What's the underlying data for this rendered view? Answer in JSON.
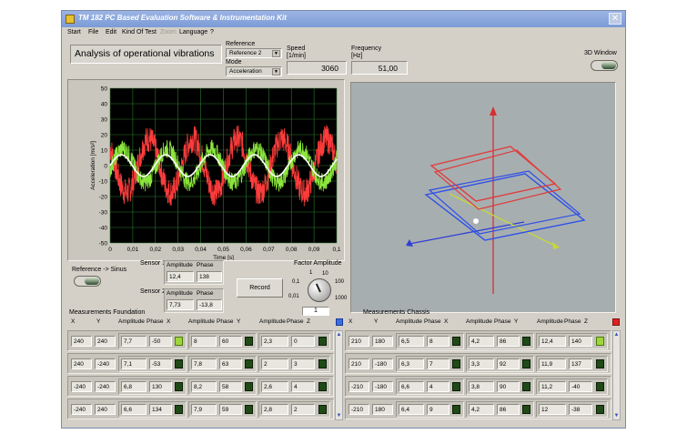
{
  "window": {
    "title": "TM 182 PC Based Evaluation Software & Instrumentation Kit",
    "close_label": "✕"
  },
  "menu": [
    "Start",
    "File",
    "Edit",
    "Kind Of Test",
    "Zoom",
    "Language",
    "?"
  ],
  "header": {
    "analysis_title": "Analysis of operational vibrations",
    "reference_label": "Reference",
    "reference_value": "Reference 2",
    "mode_label": "Mode",
    "mode_value": "Acceleration",
    "speed_label": "Speed",
    "speed_unit": "[1/min]",
    "speed_value": "3060",
    "frequency_label": "Frequency",
    "frequency_unit": "[Hz]",
    "frequency_value": "51,00",
    "window3d_label": "3D Window"
  },
  "chart_data": {
    "type": "line",
    "xlabel": "Time [s]",
    "ylabel": "Acceleration [m/s²]",
    "xlim": [
      0,
      0.1
    ],
    "ylim": [
      -50,
      50
    ],
    "xticks": [
      "0",
      "0,01",
      "0,02",
      "0,03",
      "0,04",
      "0,05",
      "0,06",
      "0,07",
      "0,08",
      "0,09",
      "0,1"
    ],
    "yticks": [
      "50",
      "40",
      "30",
      "20",
      "10",
      "0",
      "-10",
      "-20",
      "-30",
      "-40",
      "-50"
    ],
    "grid": true,
    "background": "#000000",
    "series": [
      {
        "color": "#ff3c3c",
        "amplitude": 12.4,
        "phase_deg": 138,
        "frequency_hz": 51,
        "noise": 9
      },
      {
        "color": "#8ce63c",
        "amplitude": 7.73,
        "phase_deg": -13.8,
        "frequency_hz": 51,
        "noise": 6
      },
      {
        "color": "#ffffff",
        "amplitude": 5,
        "phase_deg": 0,
        "frequency_hz": 51,
        "noise": 0
      }
    ]
  },
  "controls": {
    "reference_sinus_label": "Reference -> Sinus",
    "sensor1_label": "Sensor 1",
    "sensor2_label": "Sensor 2",
    "amplitude_label": "Amplitude",
    "phase_label": "Phase",
    "sensor1_amplitude": "12,4",
    "sensor1_phase": "138",
    "sensor2_amplitude": "7,73",
    "sensor2_phase": "-13,8",
    "record_label": "Record",
    "factor_label": "Factor Amplitude",
    "knob_ticks": [
      "0,01",
      "0,1",
      "1",
      "10",
      "100",
      "1000"
    ],
    "factor_value": "1"
  },
  "foundation": {
    "title": "Measurements Foundation",
    "headers": [
      "X",
      "Y",
      "Amplitude",
      "Phase",
      "X",
      "Amplitude",
      "Phase",
      "Y",
      "Amplitude",
      "Phase",
      "Z"
    ],
    "indicator_color": "#3a6ee8",
    "rows": [
      {
        "x": "240",
        "y": "240",
        "a1": "7,7",
        "p1": "-50",
        "l1": true,
        "a2": "8",
        "p2": "60",
        "l2": false,
        "a3": "2,3",
        "p3": "0",
        "l3": false
      },
      {
        "x": "240",
        "y": "-240",
        "a1": "7,1",
        "p1": "-53",
        "l1": false,
        "a2": "7,8",
        "p2": "63",
        "l2": false,
        "a3": "2",
        "p3": "3",
        "l3": false
      },
      {
        "x": "-240",
        "y": "-240",
        "a1": "6,8",
        "p1": "130",
        "l1": false,
        "a2": "8,2",
        "p2": "58",
        "l2": false,
        "a3": "2,6",
        "p3": "4",
        "l3": false
      },
      {
        "x": "-240",
        "y": "240",
        "a1": "6,6",
        "p1": "134",
        "l1": false,
        "a2": "7,9",
        "p2": "59",
        "l2": false,
        "a3": "2,8",
        "p3": "2",
        "l3": false
      }
    ]
  },
  "chassis": {
    "title": "Measurements Chassis",
    "headers": [
      "X",
      "Y",
      "Amplitude",
      "Phase",
      "X",
      "Amplitude",
      "Phase",
      "Y",
      "Amplitude",
      "Phase",
      "Z"
    ],
    "indicator_color": "#e02020",
    "rows": [
      {
        "x": "210",
        "y": "180",
        "a1": "6,5",
        "p1": "8",
        "l1": false,
        "a2": "4,2",
        "p2": "86",
        "l2": false,
        "a3": "12,4",
        "p3": "140",
        "l3": true
      },
      {
        "x": "210",
        "y": "-180",
        "a1": "6,3",
        "p1": "7",
        "l1": false,
        "a2": "3,3",
        "p2": "92",
        "l2": false,
        "a3": "11,9",
        "p3": "137",
        "l3": false
      },
      {
        "x": "-210",
        "y": "-180",
        "a1": "6,6",
        "p1": "4",
        "l1": false,
        "a2": "3,8",
        "p2": "90",
        "l2": false,
        "a3": "11,2",
        "p3": "-40",
        "l3": false
      },
      {
        "x": "-210",
        "y": "180",
        "a1": "6,4",
        "p1": "9",
        "l1": false,
        "a2": "4,2",
        "p2": "86",
        "l2": false,
        "a3": "12",
        "p3": "-38",
        "l3": false
      }
    ]
  }
}
